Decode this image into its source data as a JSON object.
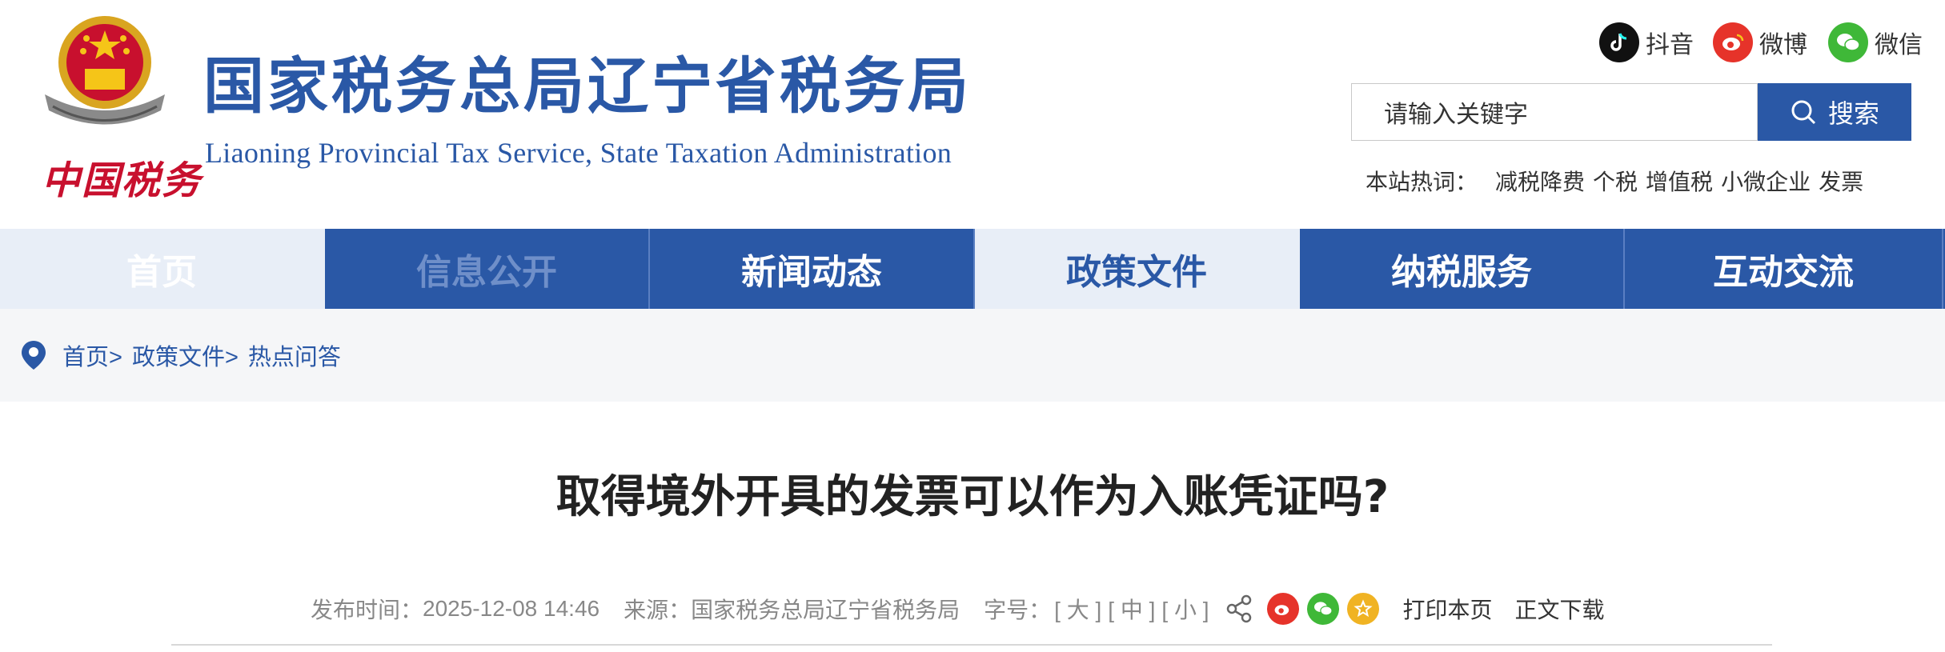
{
  "header": {
    "site_title_cn": "国家税务总局辽宁省税务局",
    "site_title_en": "Liaoning Provincial Tax Service, State Taxation Administration",
    "logo_signature": "中国税务",
    "social": [
      {
        "label": "抖音",
        "icon": "douyin-icon",
        "color": "#111111"
      },
      {
        "label": "微博",
        "icon": "weibo-icon",
        "color": "#e6332a"
      },
      {
        "label": "微信",
        "icon": "wechat-icon",
        "color": "#3fb838"
      }
    ],
    "search": {
      "placeholder": "请输入关键字",
      "button_label": "搜索"
    },
    "hot": {
      "label": "本站热词：",
      "items": [
        "减税降费",
        "个税",
        "增值税",
        "小微企业",
        "发票"
      ]
    }
  },
  "nav": {
    "items": [
      {
        "label": "首页"
      },
      {
        "label": "信息公开"
      },
      {
        "label": "新闻动态"
      },
      {
        "label": "政策文件"
      },
      {
        "label": "纳税服务"
      },
      {
        "label": "互动交流"
      }
    ]
  },
  "breadcrumb": {
    "items": [
      "首页>",
      "政策文件>",
      "热点问答"
    ]
  },
  "article": {
    "title": "取得境外开具的发票可以作为入账凭证吗?",
    "publish_label": "发布时间：",
    "publish_time": "2025-12-08 14:46",
    "source_label": "来源：",
    "source": "国家税务总局辽宁省税务局",
    "font_label": "字号：",
    "font_sizes": [
      "[ 大 ]",
      "[ 中 ]",
      "[ 小 ]"
    ],
    "print_label": "打印本页",
    "download_label": "正文下载"
  },
  "colors": {
    "brand_blue": "#2a58a6",
    "nav_light": "#e8eef7",
    "breadcrumb_bg": "#f5f6f8",
    "weibo_red": "#e6332a",
    "wechat_green": "#3fb838",
    "favorite_gold": "#f0b323"
  }
}
